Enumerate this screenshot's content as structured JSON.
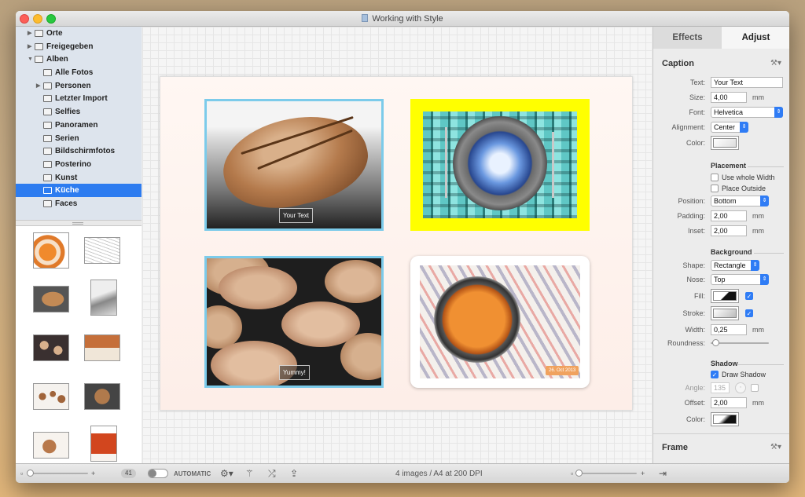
{
  "window": {
    "title": "Working with Style"
  },
  "sidebar": {
    "items": [
      {
        "label": "Orte",
        "level": 0,
        "disclosure": "▶"
      },
      {
        "label": "Freigegeben",
        "level": 0,
        "disclosure": "▶"
      },
      {
        "label": "Alben",
        "level": 0,
        "disclosure": "▼"
      },
      {
        "label": "Alle Fotos",
        "level": 1,
        "disclosure": ""
      },
      {
        "label": "Personen",
        "level": 1,
        "disclosure": "▶"
      },
      {
        "label": "Letzter Import",
        "level": 1,
        "disclosure": ""
      },
      {
        "label": "Selfies",
        "level": 1,
        "disclosure": ""
      },
      {
        "label": "Panoramen",
        "level": 1,
        "disclosure": ""
      },
      {
        "label": "Serien",
        "level": 1,
        "disclosure": ""
      },
      {
        "label": "Bildschirmfotos",
        "level": 1,
        "disclosure": ""
      },
      {
        "label": "Posterino",
        "level": 1,
        "disclosure": ""
      },
      {
        "label": "Kunst",
        "level": 1,
        "disclosure": ""
      },
      {
        "label": "Küche",
        "level": 1,
        "disclosure": "",
        "selected": true
      },
      {
        "label": "Faces",
        "level": 1,
        "disclosure": ""
      }
    ]
  },
  "canvas": {
    "captions": {
      "bread": "Your Text",
      "rolls": "Yummy!",
      "cake": "26. Oct 2013"
    },
    "colors": {
      "frame1_border": "#7ccbea",
      "frame2_bg": "#ffff00",
      "frame3_border": "#7ccbea"
    }
  },
  "inspector": {
    "tabs": {
      "effects": "Effects",
      "adjust": "Adjust"
    },
    "caption": {
      "title": "Caption",
      "text_label": "Text:",
      "text_value": "Your Text",
      "size_label": "Size:",
      "size_value": "4,00",
      "size_unit": "mm",
      "font_label": "Font:",
      "font_value": "Helvetica",
      "alignment_label": "Alignment:",
      "alignment_value": "Center",
      "color_label": "Color:"
    },
    "placement": {
      "title": "Placement",
      "use_whole_width": "Use whole Width",
      "place_outside": "Place Outside",
      "position_label": "Position:",
      "position_value": "Bottom",
      "padding_label": "Padding:",
      "padding_value": "2,00",
      "padding_unit": "mm",
      "inset_label": "Inset:",
      "inset_value": "2,00",
      "inset_unit": "mm"
    },
    "background": {
      "title": "Background",
      "shape_label": "Shape:",
      "shape_value": "Rectangle",
      "nose_label": "Nose:",
      "nose_value": "Top",
      "fill_label": "Fill:",
      "stroke_label": "Stroke:",
      "width_label": "Width:",
      "width_value": "0,25",
      "width_unit": "mm",
      "roundness_label": "Roundness:",
      "roundness_value": 0.08
    },
    "shadow": {
      "title": "Shadow",
      "draw_shadow": "Draw Shadow",
      "angle_label": "Angle:",
      "angle_value": "135",
      "offset_label": "Offset:",
      "offset_value": "2,00",
      "offset_unit": "mm",
      "color_label": "Color:"
    },
    "frame": {
      "title": "Frame"
    }
  },
  "bottombar": {
    "thumb_count": "41",
    "automatic": "AUTOMATIC",
    "status": "4 images / A4 at 200 DPI"
  }
}
